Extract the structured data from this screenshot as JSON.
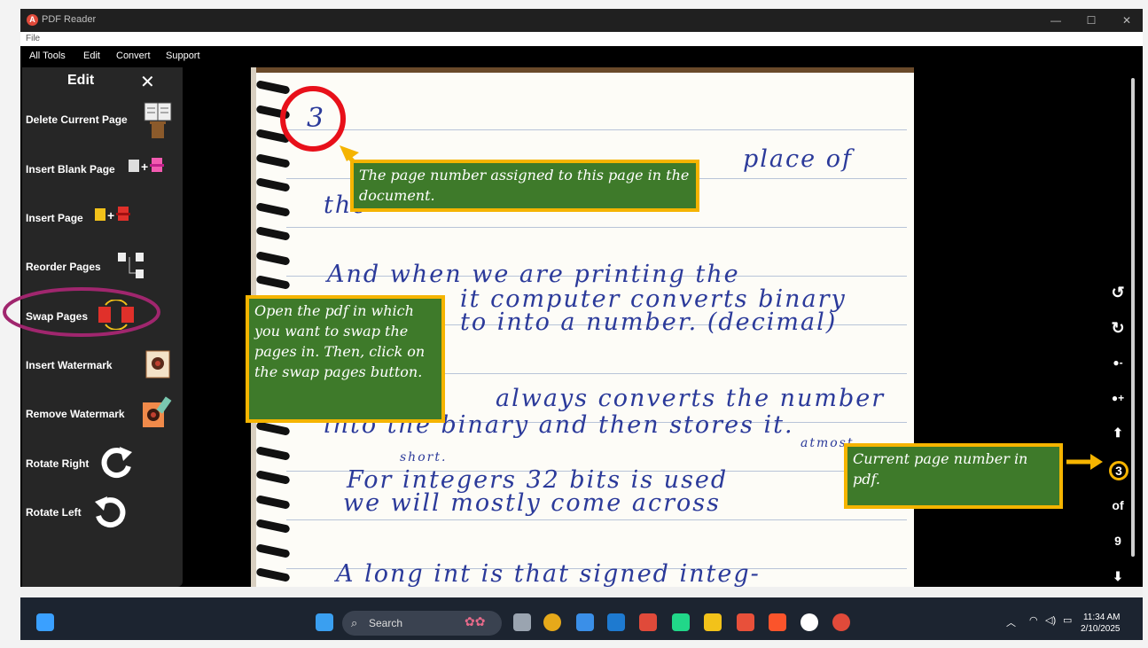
{
  "window": {
    "title": "PDF Reader",
    "app_icon_letter": "A",
    "minimize": "—",
    "maximize": "☐",
    "close": "✕"
  },
  "file_menu": "File",
  "menubar": {
    "items": [
      "All Tools",
      "Edit",
      "Convert",
      "Support"
    ]
  },
  "sidebar": {
    "heading": "Edit",
    "close_glyph": "✕",
    "items": [
      {
        "label": "Delete Current Page",
        "icon": "delete-page-icon"
      },
      {
        "label": "Insert Blank Page",
        "icon": "insert-blank-icon"
      },
      {
        "label": "Insert Page",
        "icon": "insert-page-icon"
      },
      {
        "label": "Reorder Pages",
        "icon": "reorder-icon"
      },
      {
        "label": "Swap Pages",
        "icon": "swap-icon"
      },
      {
        "label": "Insert Watermark",
        "icon": "watermark-icon"
      },
      {
        "label": "Remove Watermark",
        "icon": "remove-watermark-icon"
      },
      {
        "label": "Rotate Right",
        "icon": "rotate-right-icon"
      },
      {
        "label": "Rotate Left",
        "icon": "rotate-left-icon"
      }
    ]
  },
  "handwriting": {
    "page_number": "3",
    "lines": [
      "place of",
      "the",
      "And when we are printing the",
      "it computer converts binary",
      "to into a number. (decimal)",
      "always converts the number",
      "into the binary and then stores it.",
      "atmost",
      "short.",
      "For integers 32 bits is used",
      "we will mostly come across",
      "A long int is that signed integ-"
    ]
  },
  "page_nav": {
    "current_page": "3",
    "of_label": "of",
    "total_pages": "9"
  },
  "callouts": {
    "page_number": "The page number assigned to this page in the document.",
    "swap": "Open the pdf in which you want to swap the pages in. Then, click on the swap pages button.",
    "current": "Current page number in pdf."
  },
  "taskbar": {
    "search_placeholder": "Search",
    "time": "11:34 AM",
    "date": "2/10/2025"
  },
  "colors": {
    "callout_bg": "#3e7a2a",
    "callout_border": "#f5b400",
    "highlight_red": "#e8101a",
    "highlight_purple": "#a0266e"
  }
}
